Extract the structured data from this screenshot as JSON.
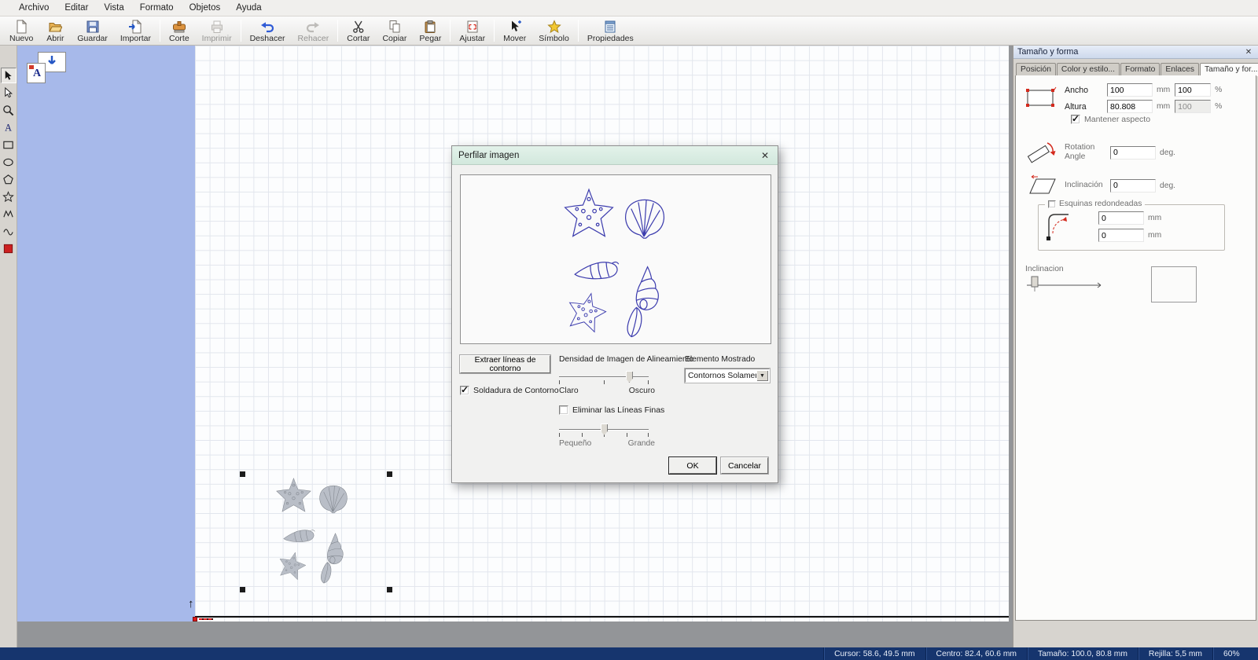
{
  "menu": {
    "items": [
      "Archivo",
      "Editar",
      "Vista",
      "Formato",
      "Objetos",
      "Ayuda"
    ]
  },
  "toolbar": {
    "buttons": [
      {
        "label": "Nuevo"
      },
      {
        "label": "Abrir"
      },
      {
        "label": "Guardar"
      },
      {
        "label": "Importar"
      },
      {
        "label": "Corte"
      },
      {
        "label": "Imprimir",
        "disabled": true
      },
      {
        "label": "Deshacer"
      },
      {
        "label": "Rehacer",
        "disabled": true
      },
      {
        "label": "Cortar"
      },
      {
        "label": "Copiar"
      },
      {
        "label": "Pegar"
      },
      {
        "label": "Ajustar"
      },
      {
        "label": "Mover"
      },
      {
        "label": "Símbolo"
      },
      {
        "label": "Propiedades"
      }
    ]
  },
  "dialog": {
    "title": "Perfilar imagen",
    "extract_button": "Extraer líneas de contorno",
    "weld_label": "Soldadura de Contorno",
    "weld_checked": true,
    "density": {
      "label": "Densidad de Imagen de Alineamiento",
      "left": "Claro",
      "right": "Oscuro",
      "value_pct": 78
    },
    "thin_lines_label": "Eliminar las Líneas Finas",
    "thin_lines_checked": false,
    "size_slider": {
      "left": "Pequeño",
      "right": "Grande",
      "value_pct": 50
    },
    "element": {
      "label": "Elemento Mostrado",
      "value": "Contornos Solamente"
    },
    "ok": "OK",
    "cancel": "Cancelar"
  },
  "panel": {
    "title": "Tamaño y forma",
    "tabs": [
      "Posición",
      "Color y estilo...",
      "Formato",
      "Enlaces",
      "Tamaño y for..."
    ],
    "active_tab": "Tamaño y for...",
    "size": {
      "width_label": "Ancho",
      "height_label": "Altura",
      "width_mm": "100",
      "height_mm": "80.808",
      "width_pct": "100",
      "height_pct": "100",
      "keep_aspect": "Mantener aspecto"
    },
    "rotation": {
      "label": "Rotation Angle",
      "value": "0"
    },
    "skew": {
      "label": "Inclinación",
      "value": "0"
    },
    "corners": {
      "label": "Esquinas redondeadas",
      "r1": "0",
      "r2": "0"
    },
    "slant": {
      "label": "Inclinacion"
    },
    "units": {
      "mm": "mm",
      "pct": "%",
      "deg": "deg."
    }
  },
  "statusbar": {
    "cursor": "Cursor: 58.6, 49.5 mm",
    "center": "Centro: 82.4, 60.6 mm",
    "size": "Tamaño: 100.0, 80.8 mm",
    "grid": "Rejilla: 5,5 mm",
    "zoom": "60%"
  },
  "colors": {
    "outline_blue": "#3d3dae",
    "page_blue": "#a7b9ea",
    "status_navy": "#16356e",
    "dialog_titlebar": "#d9ece2"
  }
}
